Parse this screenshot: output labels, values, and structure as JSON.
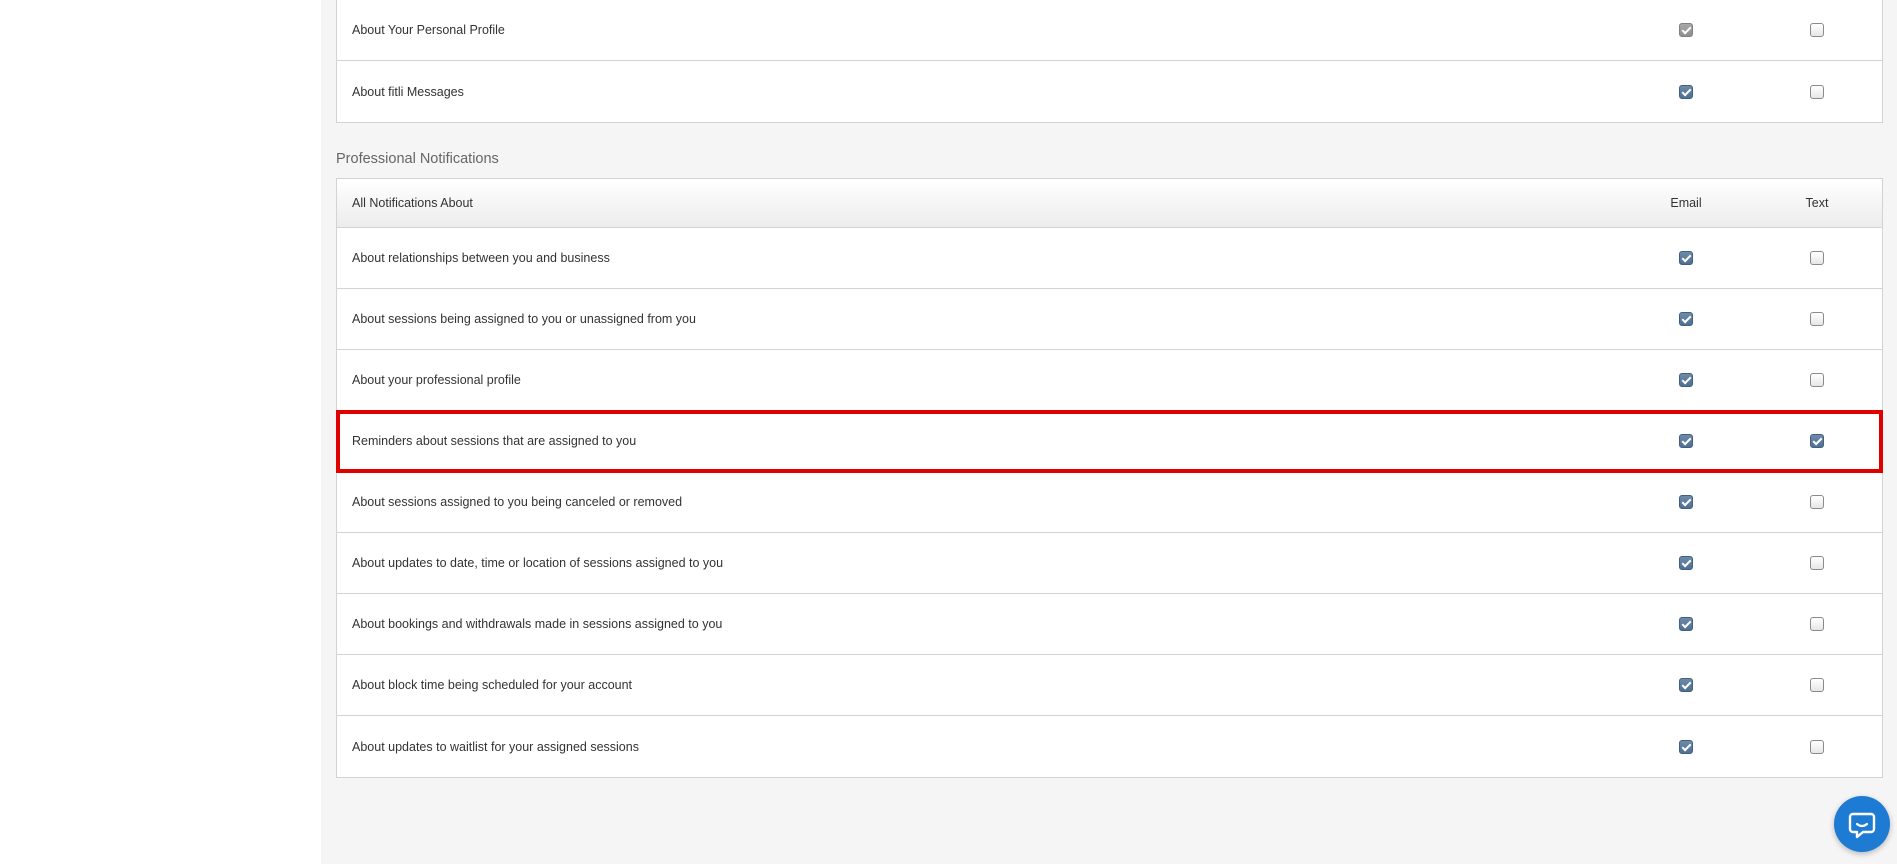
{
  "top_table": {
    "rows": [
      {
        "label": "About Your Personal Profile",
        "email": true,
        "email_muted": true,
        "text": false
      },
      {
        "label": "About fitli Messages",
        "email": true,
        "email_muted": false,
        "text": false
      }
    ]
  },
  "professional": {
    "section_title": "Professional Notifications",
    "header": {
      "label": "All Notifications About",
      "email": "Email",
      "text": "Text"
    },
    "rows": [
      {
        "label": "About relationships between you and business",
        "email": true,
        "text": false
      },
      {
        "label": "About sessions being assigned to you or unassigned from you",
        "email": true,
        "text": false
      },
      {
        "label": "About your professional profile",
        "email": true,
        "text": false
      },
      {
        "label": "Reminders about sessions that are assigned to you",
        "email": true,
        "text": true,
        "highlighted": true
      },
      {
        "label": "About sessions assigned to you being canceled or removed",
        "email": true,
        "text": false
      },
      {
        "label": "About updates to date, time or location of sessions assigned to you",
        "email": true,
        "text": false
      },
      {
        "label": "About bookings and withdrawals made in sessions assigned to you",
        "email": true,
        "text": false
      },
      {
        "label": "About block time being scheduled for your account",
        "email": true,
        "text": false
      },
      {
        "label": "About updates to waitlist for your assigned sessions",
        "email": true,
        "text": false
      }
    ]
  },
  "chat_widget": {
    "icon": "chat-bubble-icon",
    "color": "#1e7bd3"
  },
  "colors": {
    "highlight": "#e10000",
    "checkbox_on": "#4f6f93",
    "background": "#f5f5f5"
  }
}
